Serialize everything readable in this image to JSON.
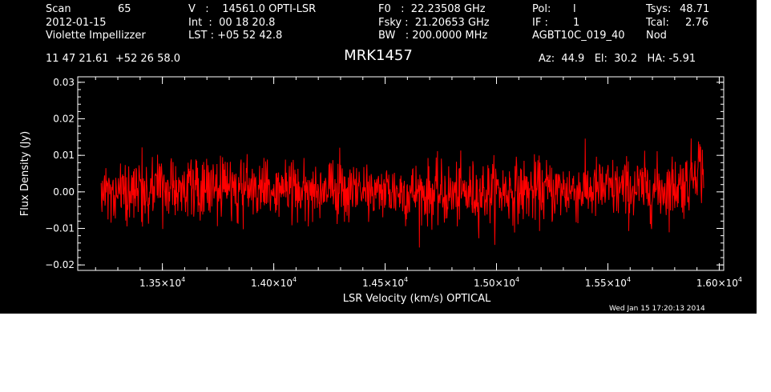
{
  "header": {
    "left": {
      "scan_label": "Scan",
      "scan_number": "65",
      "date": "2012-01-15",
      "observer": "Violette Impellizzer"
    },
    "col2": {
      "v_line": "V   :    14561.0 OPTI-LSR",
      "int_line": "Int  :  00 18 20.8",
      "lst_line": "LST : +05 52 42.8"
    },
    "col3": {
      "f0_line": "F0   :  22.23508 GHz",
      "fsky_line": "Fsky :  21.20653 GHz",
      "bw_line": "BW   : 200.0000 MHz"
    },
    "col4": {
      "pol_label": "Pol:",
      "pol_value": "l",
      "if_label": "IF :",
      "if_value": "1",
      "project": "AGBT10C_019_40"
    },
    "col5": {
      "tsys_label": "Tsys:",
      "tsys_value": "48.71",
      "tcal_label": "Tcal:",
      "tcal_value": "2.76",
      "mode": "Nod"
    },
    "coords": "11 47 21.61  +52 26 58.0",
    "azelha": "Az:  44.9   El:  30.2   HA: -5.91"
  },
  "timestamp": "Wed Jan 15 17:20:13 2014",
  "colors": {
    "background": "#000000",
    "axes": "#ffffff",
    "spectrum": "#ff0000"
  },
  "chart_data": {
    "type": "line",
    "title": "MRK1457",
    "xlabel": "LSR Velocity (km/s) OPTICAL",
    "ylabel": "Flux Density (Jy)",
    "xlim": [
      13120,
      16020
    ],
    "ylim": [
      -0.0215,
      0.0315
    ],
    "x_ticks": [
      {
        "value": 13500,
        "label": "1.35×10",
        "exp": "4"
      },
      {
        "value": 14000,
        "label": "1.40×10",
        "exp": "4"
      },
      {
        "value": 14500,
        "label": "1.45×10",
        "exp": "4"
      },
      {
        "value": 15000,
        "label": "1.50×10",
        "exp": "4"
      },
      {
        "value": 15500,
        "label": "1.55×10",
        "exp": "4"
      },
      {
        "value": 16000,
        "label": "1.60×10",
        "exp": "4"
      }
    ],
    "y_ticks": [
      {
        "value": -0.02,
        "label": "−0.02"
      },
      {
        "value": -0.01,
        "label": "−0.01"
      },
      {
        "value": 0.0,
        "label": "0.00"
      },
      {
        "value": 0.01,
        "label": "0.01"
      },
      {
        "value": 0.02,
        "label": "0.02"
      },
      {
        "value": 0.03,
        "label": "0.03"
      }
    ],
    "x_minor_step": 100,
    "y_minor_step": 0.002,
    "series": [
      {
        "color": "#ff0000",
        "x_start": 13225,
        "x_end": 15930,
        "n_points": 1400,
        "noise_rms": 0.0043,
        "seed": 1457,
        "envelope": [
          {
            "x": 13225,
            "mean": 0.0003
          },
          {
            "x": 13500,
            "mean": 0.0012
          },
          {
            "x": 14000,
            "mean": 0.0005
          },
          {
            "x": 14500,
            "mean": 0.0003
          },
          {
            "x": 14800,
            "mean": -0.0008
          },
          {
            "x": 15000,
            "mean": 0.0001
          },
          {
            "x": 15500,
            "mean": 0.0006
          },
          {
            "x": 15750,
            "mean": 0.0008
          },
          {
            "x": 15860,
            "mean": 0.0025
          },
          {
            "x": 15905,
            "mean": 0.0085
          },
          {
            "x": 15930,
            "mean": 0.004
          }
        ]
      }
    ]
  }
}
